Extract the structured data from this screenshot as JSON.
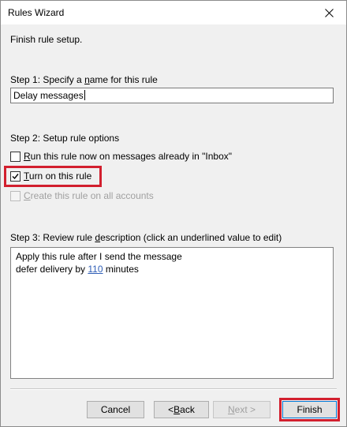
{
  "window": {
    "title": "Rules Wizard",
    "close_glyph": "✕"
  },
  "header": {
    "instruction": "Finish rule setup."
  },
  "step1": {
    "heading_pre": "Step 1: Specify a ",
    "heading_accel": "n",
    "heading_post": "ame for this rule",
    "name_value": "Delay messages"
  },
  "step2": {
    "heading": "Step 2: Setup rule options",
    "options": [
      {
        "accel": "R",
        "rest": "un this rule now on messages already in \"Inbox\"",
        "checked": false,
        "enabled": true
      },
      {
        "accel": "T",
        "rest": "urn on this rule",
        "checked": true,
        "enabled": true
      },
      {
        "accel": "C",
        "rest": "reate this rule on all accounts",
        "checked": false,
        "enabled": false
      }
    ]
  },
  "step3": {
    "heading_pre": "Step 3: Review rule ",
    "heading_accel": "d",
    "heading_post": "escription (click an underlined value to edit)",
    "line1": "Apply this rule after I send the message",
    "line2_pre": "defer delivery by ",
    "line2_link": "110",
    "line2_post": " minutes"
  },
  "buttons": {
    "cancel": "Cancel",
    "back_pre": "< ",
    "back_accel": "B",
    "back_post": "ack",
    "next_accel": "N",
    "next_post": "ext >",
    "finish": "Finish"
  },
  "icons": {
    "close": "close-icon",
    "check": "checkmark-icon"
  },
  "colors": {
    "highlight": "#d21f2e",
    "link": "#2f5eb6",
    "dialog_bg": "#f0f0f0",
    "default_button_border": "#0078d7"
  }
}
